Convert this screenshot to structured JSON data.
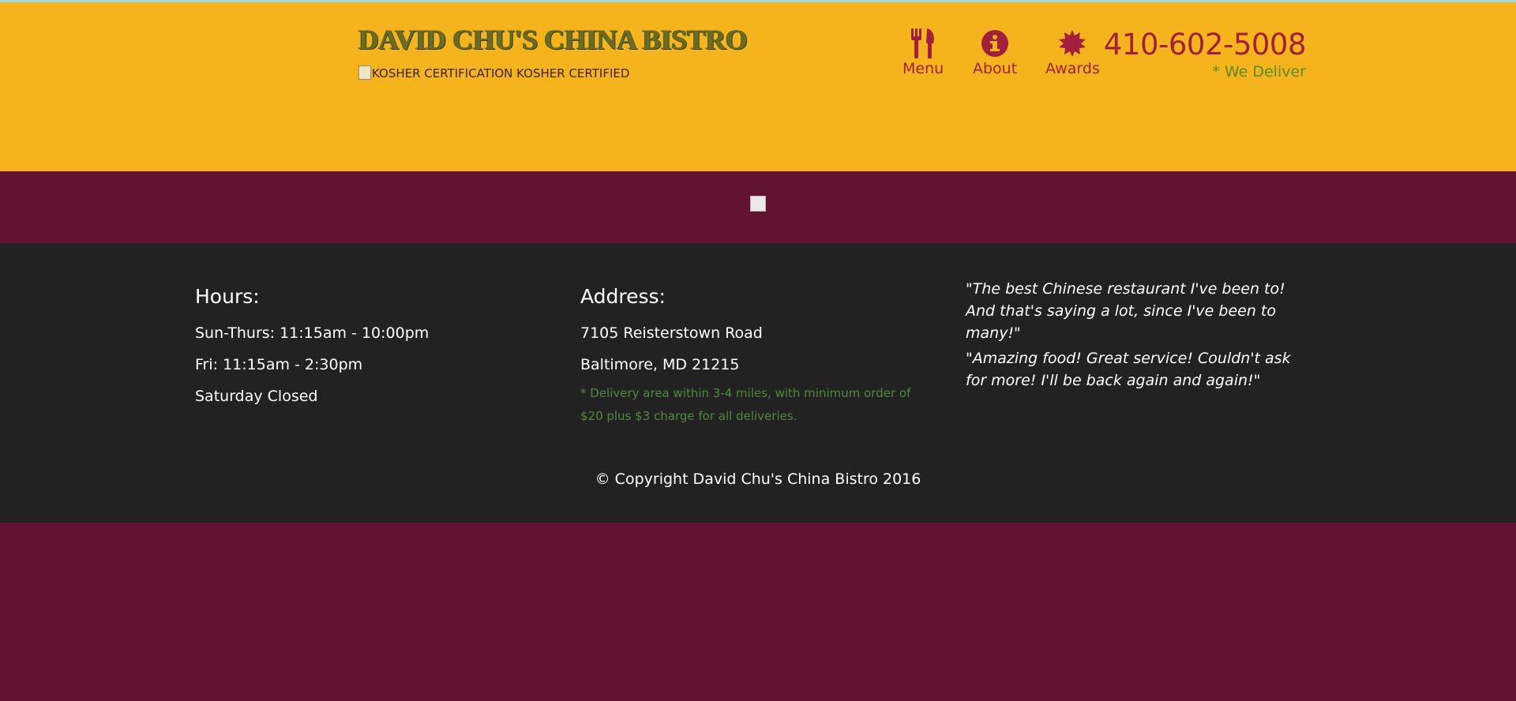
{
  "colors": {
    "header_bg": "#f5b41b",
    "accent": "#a3203c",
    "brand_green": "#6d6a22",
    "banner_bg": "#611331",
    "footer_bg": "#222222",
    "delivery_green": "#4f8a3a"
  },
  "header": {
    "brand_title": "DAVID CHU'S CHINA BISTRO",
    "kosher_text": "KOSHER CERTIFICATION KOSHER CERTIFIED",
    "nav": [
      {
        "label": "Menu",
        "icon": "fork-knife-icon"
      },
      {
        "label": "About",
        "icon": "info-circle-icon"
      },
      {
        "label": "Awards",
        "icon": "award-seal-icon"
      }
    ],
    "phone": "410-602-5008",
    "deliver_note": "* We Deliver"
  },
  "footer": {
    "hours": {
      "heading": "Hours:",
      "lines": [
        "Sun-Thurs: 11:15am - 10:00pm",
        "Fri: 11:15am - 2:30pm",
        "Saturday Closed"
      ]
    },
    "address": {
      "heading": "Address:",
      "lines": [
        "7105 Reisterstown Road",
        "Baltimore, MD 21215"
      ],
      "delivery_note": "* Delivery area within 3-4 miles, with minimum order of $20 plus $3 charge for all deliveries."
    },
    "testimonials": [
      "\"The best Chinese restaurant I've been to! And that's saying a lot, since I've been to many!\"",
      "\"Amazing food! Great service! Couldn't ask for more! I'll be back again and again!\""
    ],
    "copyright": "© Copyright David Chu's China Bistro 2016"
  }
}
